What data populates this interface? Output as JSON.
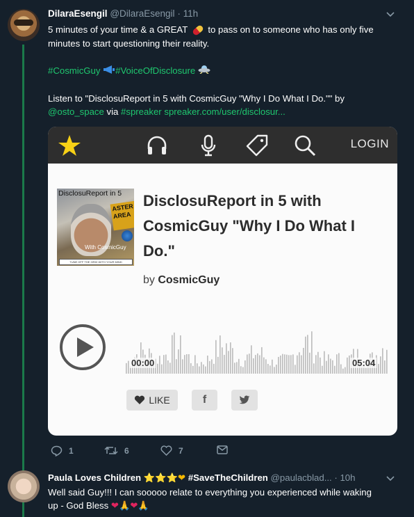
{
  "tweet": {
    "author_name": "DilaraEsengil",
    "author_handle": "@DilaraEsengil",
    "separator": "·",
    "time": "11h",
    "line1_a": "5 minutes of your time & a GREAT ",
    "line1_b": " to pass on to someone who has only five",
    "line2": "minutes to start questioning their reality.",
    "hashtag1": "#CosmicGuy",
    "hashtag2": "#VoiceOfDisclosure",
    "listen_text": "Listen to \"DisclosuReport in 5 with CosmicGuy \"Why I Do What I Do.\"\" by",
    "mention": "@osto_space",
    "via": " via ",
    "hashtag3": "#spreaker",
    "link": "spreaker.com/user/disclosur...",
    "icon_pill": "pill-emoji",
    "icon_megaphone": "megaphone-emoji",
    "icon_ufo": "ufo-emoji"
  },
  "card": {
    "nav_login": "LOGIN",
    "cover_title": "DisclosuReport in 5",
    "cover_sub": "With CosmicGuy",
    "cover_sign": "ASTER AREA",
    "cover_bar": "TUNE OFF THE GRID WITH YOUR MIND",
    "title": "DisclosuReport in 5 with CosmicGuy \"Why I Do What I Do.\"",
    "by_prefix": "by ",
    "author": "CosmicGuy",
    "time_start": "00:00",
    "time_end": "05:04",
    "like_label": "LIKE",
    "fb_label": "f",
    "accent": "#f7d116"
  },
  "actions": {
    "reply_count": "1",
    "retweet_count": "6",
    "like_count": "7"
  },
  "reply": {
    "author_name": "Paula Loves Children",
    "badges": "⭐⭐⭐❤",
    "hashtag": "#SaveTheChildren",
    "handle": "@paulacblad...",
    "separator": "·",
    "time": "10h",
    "text_line1": "Well said Guy!!! I can sooooo relate to everything you experienced while waking",
    "text_line2": "up - God Bless ",
    "text_emoji": "❤🙏❤🙏"
  },
  "colors": {
    "background": "#15202b",
    "thread_line": "#1b7a4a",
    "link_green": "#1fc76f",
    "muted": "#8899a6"
  }
}
